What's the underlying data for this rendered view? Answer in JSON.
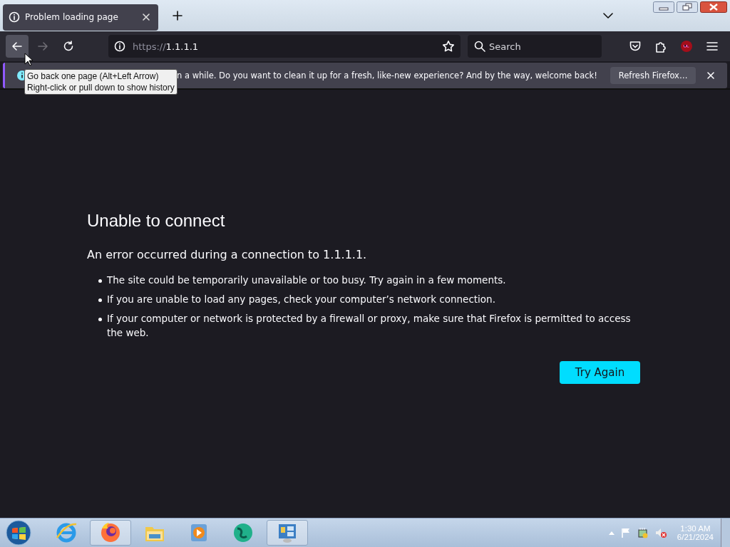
{
  "tabs": [
    {
      "title": "Problem loading page",
      "selected": true
    }
  ],
  "navigation": [
    {
      "kind": "back",
      "disabled": false,
      "hovered": true
    },
    {
      "kind": "forward",
      "disabled": true,
      "hovered": false
    },
    {
      "kind": "reload",
      "disabled": false,
      "hovered": false
    }
  ],
  "address_bar": {
    "scheme": "https://",
    "host": "1.1.1.1"
  },
  "search": {
    "placeholder": "Search"
  },
  "notification": {
    "message": "n a while. Do you want to clean it up for a fresh, like-new experience? And by the way, welcome back!",
    "button": "Refresh Firefox…"
  },
  "tooltip": {
    "lines": [
      "Go back one page (Alt+Left Arrow)",
      "Right-click or pull down to show history"
    ]
  },
  "error": {
    "title": "Unable to connect",
    "description": "An error occurred during a connection to 1.1.1.1.",
    "items": [
      "The site could be temporarily unavailable or too busy. Try again in a few moments.",
      "If you are unable to load any pages, check your computer’s network connection.",
      "If your computer or network is protected by a firewall or proxy, make sure that Firefox is permitted to access the web."
    ],
    "button": "Try Again"
  },
  "taskbar": {
    "apps": [
      {
        "kind": "browser-e",
        "running": false
      },
      {
        "kind": "firefox",
        "running": true
      },
      {
        "kind": "folder",
        "running": false
      },
      {
        "kind": "media",
        "running": false
      },
      {
        "kind": "globe",
        "running": false
      },
      {
        "kind": "panel",
        "running": true
      }
    ],
    "clock": {
      "time": "1:30 AM",
      "date": "6/21/2024"
    }
  }
}
